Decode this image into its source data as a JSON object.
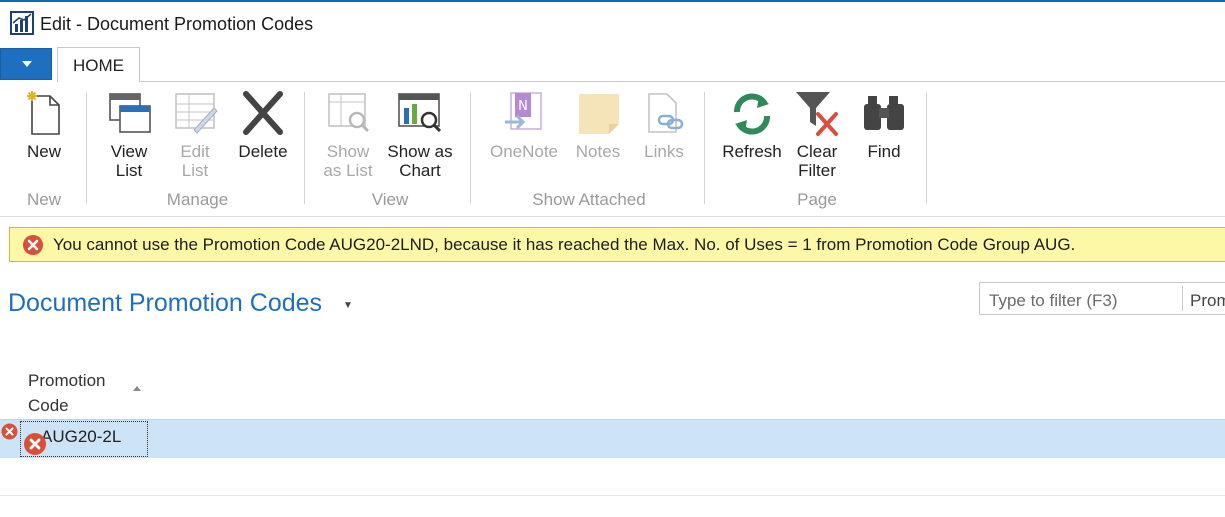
{
  "window": {
    "title": "Edit - Document Promotion Codes"
  },
  "ribbon": {
    "tab": "HOME",
    "buttons": {
      "new": "New",
      "view_list": "View\nList",
      "edit_list": "Edit\nList",
      "delete": "Delete",
      "show_as_list": "Show\nas List",
      "show_as_chart": "Show as\nChart",
      "onenote": "OneNote",
      "notes": "Notes",
      "links": "Links",
      "refresh": "Refresh",
      "clear_filter": "Clear\nFilter",
      "find": "Find"
    },
    "groups": {
      "new": "New",
      "manage": "Manage",
      "view": "View",
      "show_attached": "Show Attached",
      "page": "Page"
    }
  },
  "error_message": "You cannot use the Promotion Code AUG20-2LND, because it has reached the Max. No. of Uses = 1 from Promotion Code Group AUG.",
  "page": {
    "heading": "Document Promotion Codes",
    "filter": {
      "placeholder": "Type to filter (F3)",
      "field": "Prom"
    }
  },
  "table": {
    "column_header": "Promotion\nCode",
    "rows": [
      {
        "promotion_code": "AUG20-2L"
      }
    ]
  },
  "colors": {
    "accent": "#1f6fc0",
    "error": "#d9503a",
    "error_bar": "#fdf8a6",
    "selection": "#cde3f6"
  }
}
